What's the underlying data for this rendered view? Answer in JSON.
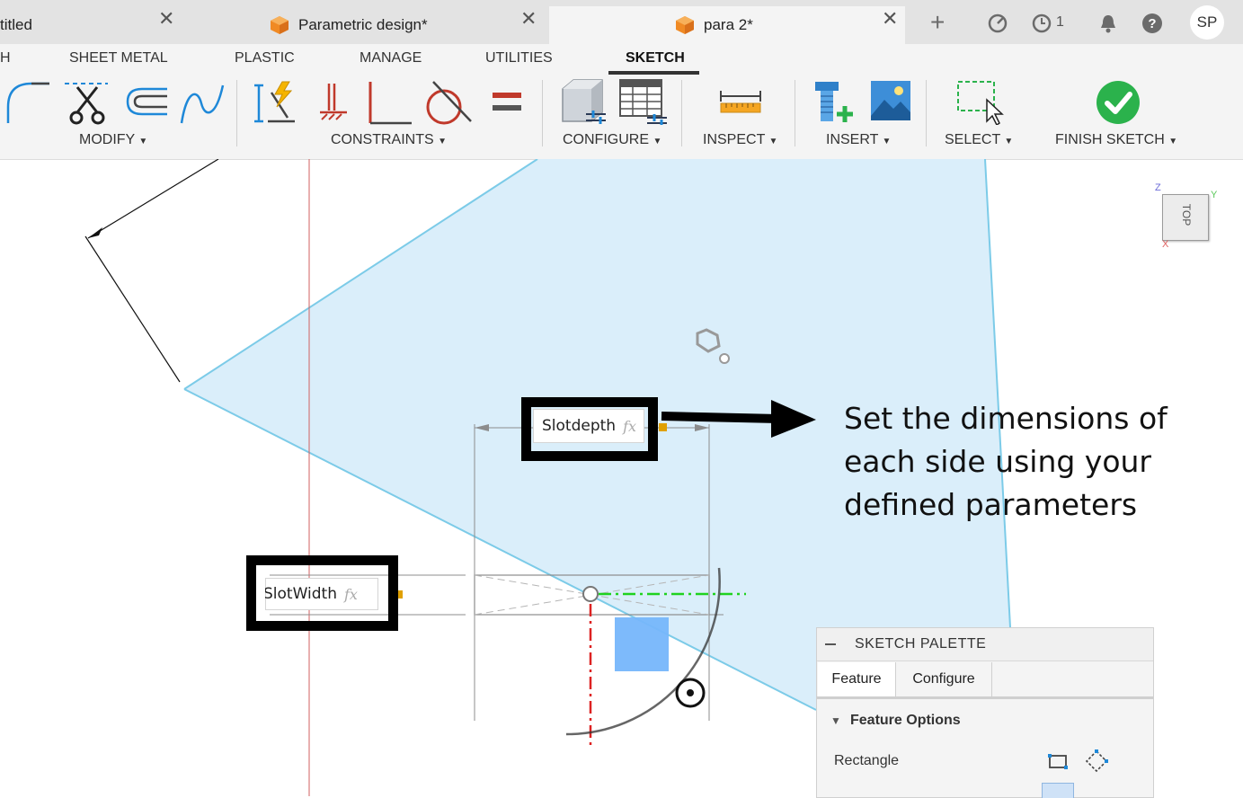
{
  "tabs": [
    {
      "label": "titled",
      "active": false
    },
    {
      "label": "Parametric design*",
      "active": false
    },
    {
      "label": "para 2*",
      "active": true
    }
  ],
  "toolbar_right": {
    "jobs_count": "1",
    "avatar_initials": "SP"
  },
  "ribbon_tabs": [
    "H",
    "SHEET METAL",
    "PLASTIC",
    "MANAGE",
    "UTILITIES",
    "SKETCH"
  ],
  "active_ribbon_tab": "SKETCH",
  "groups": {
    "modify": "MODIFY",
    "constraints": "CONSTRAINTS",
    "configure": "CONFIGURE",
    "inspect": "INSPECT",
    "insert": "INSERT",
    "select": "SELECT",
    "finish": "FINISH SKETCH"
  },
  "viewcube": {
    "face": "TOP",
    "axis_z": "Z",
    "axis_y": "Y",
    "axis_x": "X"
  },
  "dimensions": {
    "slotdepth": {
      "value": "Slotdepth",
      "fx": "fx"
    },
    "slotwidth": {
      "value": "SlotWidth",
      "fx": "fx"
    }
  },
  "annotation": "Set the dimensions of each side using your defined parameters",
  "palette": {
    "title": "SKETCH PALETTE",
    "tabs": [
      "Feature",
      "Configure"
    ],
    "section": "Feature Options",
    "row_label": "Rectangle"
  },
  "colors": {
    "plane_fill": "#daeefa",
    "plane_edge": "#7ccbe8",
    "red_axis": "#cc3333",
    "green_axis": "#1fd21f",
    "finish_green": "#2bb24c",
    "accent_blue": "#1e88d8"
  }
}
